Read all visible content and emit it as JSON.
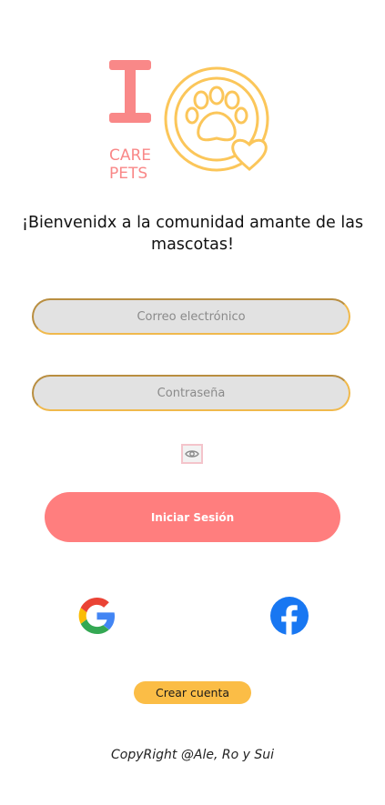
{
  "logo": {
    "letter": "I",
    "line1": "CARE",
    "line2": "PETS",
    "colors": {
      "pink": "#f98888",
      "gold": "#fbc65a"
    }
  },
  "welcome_text": "¡Bienvenidx a la comunidad amante de las mascotas!",
  "email": {
    "placeholder": "Correo electrónico",
    "value": ""
  },
  "password": {
    "placeholder": "Contraseña",
    "value": ""
  },
  "toggle_password_icon": "eye-icon",
  "login_button": {
    "label": "Iniciar Sesión"
  },
  "social": {
    "google_icon": "google-icon",
    "facebook_icon": "facebook-icon"
  },
  "create_account": {
    "label": "Crear cuenta"
  },
  "footer": {
    "text": "CopyRight @Ale, Ro y Sui"
  },
  "theme": {
    "primary": "#ff7e7e",
    "accent": "#fbbd46",
    "field_bg": "#e2e2e2",
    "field_border": "#f0b94c"
  }
}
